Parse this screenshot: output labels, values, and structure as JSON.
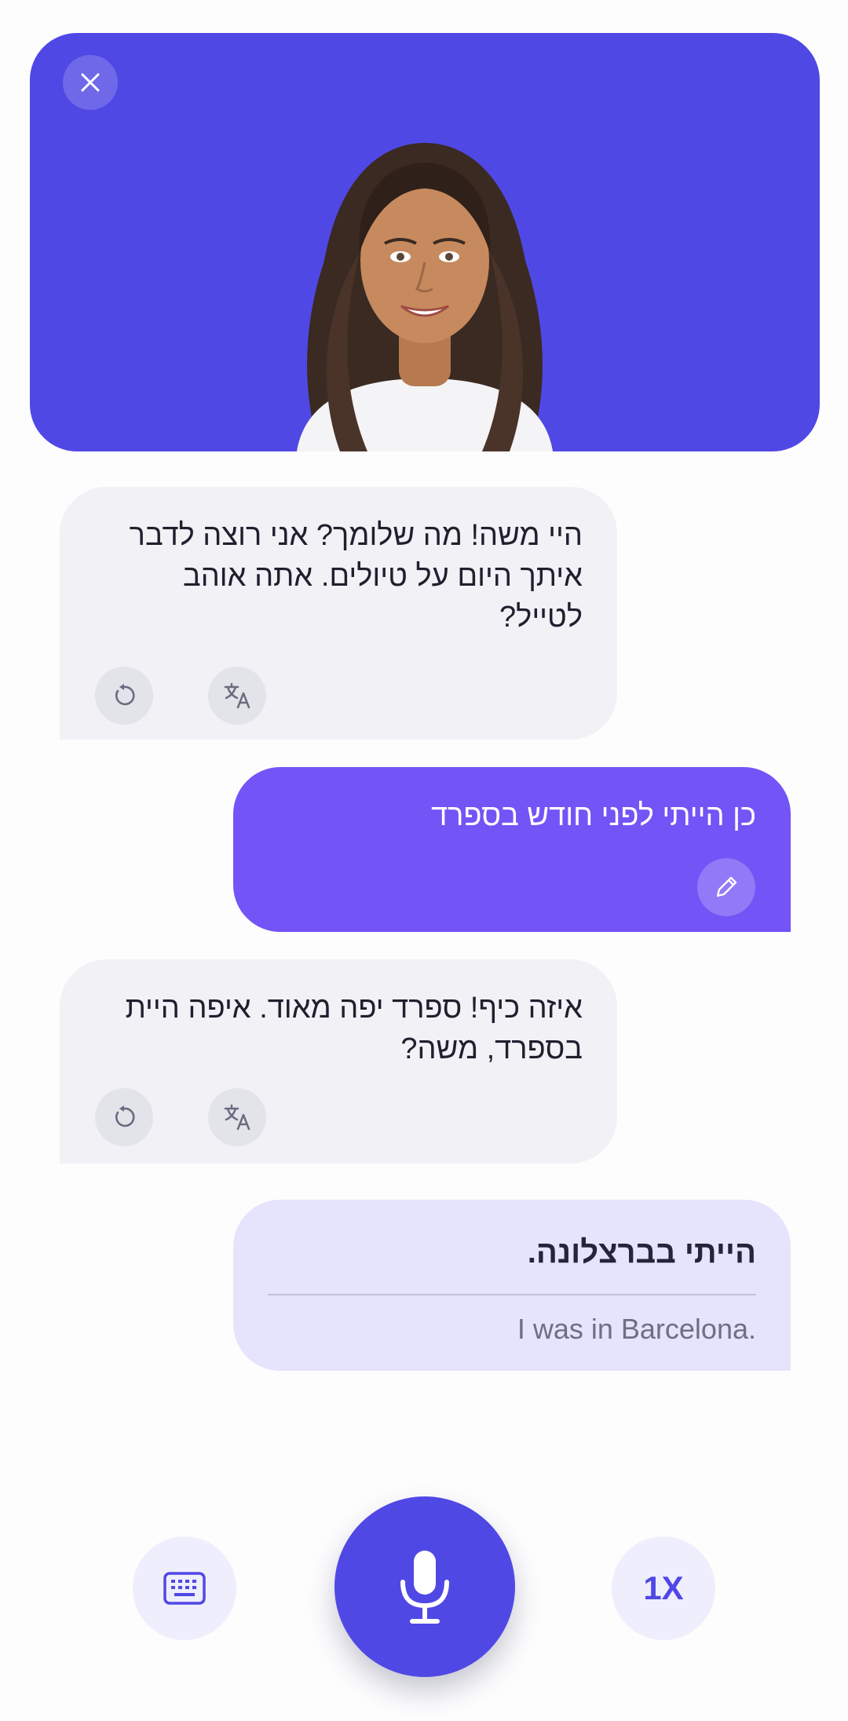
{
  "colors": {
    "primary": "#5048e5",
    "user_bubble": "#7354f6",
    "bot_bubble": "#f1f1f6",
    "pending_bubble": "#e6e4fc"
  },
  "header": {
    "close_icon": "close-icon",
    "avatar": "tutor-avatar"
  },
  "messages": [
    {
      "role": "bot",
      "text": "היי משה! מה שלומך? אני רוצה לדבר איתך היום על טיולים. אתה אוהב לטייל?",
      "icons": [
        "replay-icon",
        "translate-icon"
      ]
    },
    {
      "role": "user",
      "text": "כן הייתי לפני חודש בספרד",
      "icons": [
        "edit-icon"
      ]
    },
    {
      "role": "bot",
      "text": "איזה כיף! ספרד יפה מאוד. איפה היית בספרד, משה?",
      "icons": [
        "replay-icon",
        "translate-icon"
      ]
    }
  ],
  "pending": {
    "text": "הייתי בברצלונה.",
    "translation": "I was in Barcelona."
  },
  "controls": {
    "keyboard_icon": "keyboard-icon",
    "mic_icon": "microphone-icon",
    "speed_label": "1X"
  }
}
